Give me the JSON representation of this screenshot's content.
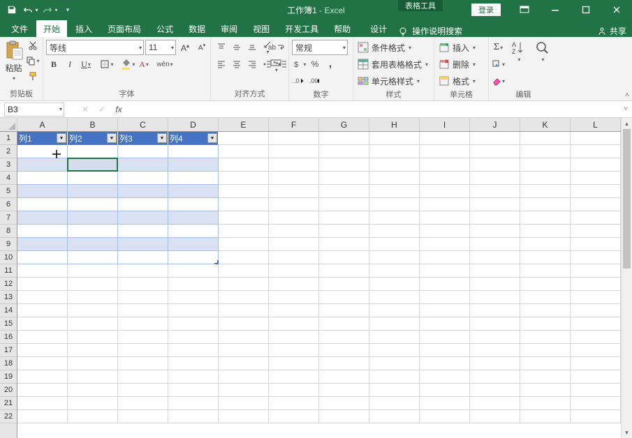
{
  "title": {
    "doc": "工作簿1",
    "sep": "  -  ",
    "app": "Excel"
  },
  "context_tab": "表格工具",
  "login": "登录",
  "tabs": {
    "file": "文件",
    "home": "开始",
    "insert": "插入",
    "layout": "页面布局",
    "formulas": "公式",
    "data": "数据",
    "review": "审阅",
    "view": "视图",
    "dev": "开发工具",
    "help": "帮助",
    "design": "设计",
    "tell_me": "操作说明搜索",
    "share": "共享"
  },
  "ribbon": {
    "clipboard": {
      "paste": "粘贴",
      "label": "剪贴板"
    },
    "font": {
      "name": "等线",
      "size": "11",
      "label": "字体",
      "wen": "wén"
    },
    "alignment": {
      "label": "对齐方式",
      "ab": "ab"
    },
    "number": {
      "format": "常规",
      "label": "数字"
    },
    "styles": {
      "cond": "条件格式",
      "table": "套用表格格式",
      "cell": "单元格样式",
      "label": "样式"
    },
    "cells": {
      "insert": "插入",
      "delete": "删除",
      "format": "格式",
      "label": "单元格"
    },
    "editing": {
      "label": "编辑"
    }
  },
  "name_box": "B3",
  "columns": [
    "A",
    "B",
    "C",
    "D",
    "E",
    "F",
    "G",
    "H",
    "I",
    "J",
    "K",
    "L"
  ],
  "rows": [
    "1",
    "2",
    "3",
    "4",
    "5",
    "6",
    "7",
    "8",
    "9",
    "10",
    "11",
    "12",
    "13",
    "14",
    "15",
    "16",
    "17",
    "18",
    "19",
    "20",
    "21",
    "22"
  ],
  "table_headers": [
    "列1",
    "列2",
    "列3",
    "列4"
  ],
  "table_rows": 9,
  "table_cols": 4,
  "selected_cell": {
    "row": 3,
    "col": 2
  },
  "chart_data": null
}
